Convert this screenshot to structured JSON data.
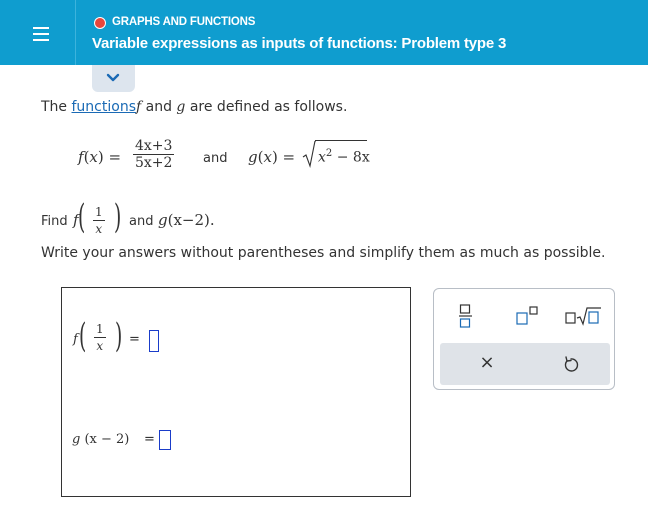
{
  "header": {
    "topic": "GRAPHS AND FUNCTIONS",
    "title": "Variable expressions as inputs of functions: Problem type 3",
    "colors": {
      "bar": "#0f9dcf",
      "status_dot": "#e8463c"
    }
  },
  "problem": {
    "intro_before": "The ",
    "intro_link": "functions",
    "intro_f": "f",
    "intro_mid": " and ",
    "intro_g": "g",
    "intro_after": " are defined as follows.",
    "f_label": "f",
    "f_open": "(",
    "f_var": "x",
    "f_close": ") =",
    "f_numerator": "4x+3",
    "f_denominator": "5x+2",
    "and_text": "and",
    "g_label": "g",
    "g_open": "(",
    "g_var": "x",
    "g_close": ") =",
    "g_radicand_x": "x",
    "g_exponent": "2",
    "g_radicand_rest": "− 8x",
    "find_text": "Find",
    "find_f": "f",
    "find_num": "1",
    "find_den": "x",
    "find_and": "and",
    "find_g": "g",
    "find_g_arg": "(x−2).",
    "instructions": "Write your answers without parentheses and simplify them as much as possible."
  },
  "answers": {
    "f_label": "f",
    "f_num": "1",
    "f_den": "x",
    "eq1": "=",
    "g_label": "g",
    "g_arg": "(x − 2)",
    "eq2": "="
  },
  "palette": {
    "fraction_icon": "fraction-icon",
    "superscript_icon": "exponent-icon",
    "sqrt_icon": "square-root-icon",
    "clear_label": "×",
    "undo_icon": "undo-icon"
  }
}
